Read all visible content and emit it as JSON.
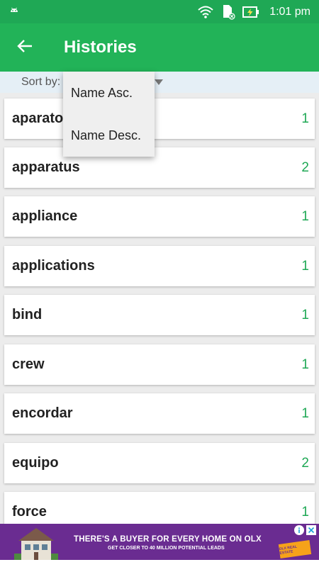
{
  "status_bar": {
    "time": "1:01 pm",
    "icons": [
      "android-icon",
      "wifi-icon",
      "sim-card-icon",
      "battery-charging-icon"
    ]
  },
  "app_bar": {
    "title": "Histories",
    "back_icon": "arrow-left-icon"
  },
  "sort_bar": {
    "label": "Sort by:"
  },
  "sort_dropdown": {
    "options": [
      "Name Asc.",
      "Name Desc."
    ]
  },
  "list": {
    "items": [
      {
        "word": "aparato",
        "count": "1"
      },
      {
        "word": "apparatus",
        "count": "2"
      },
      {
        "word": "appliance",
        "count": "1"
      },
      {
        "word": "applications",
        "count": "1"
      },
      {
        "word": "bind",
        "count": "1"
      },
      {
        "word": "crew",
        "count": "1"
      },
      {
        "word": "encordar",
        "count": "1"
      },
      {
        "word": "equipo",
        "count": "2"
      },
      {
        "word": "force",
        "count": "1"
      }
    ]
  },
  "ad": {
    "headline": "THERE'S A BUYER FOR EVERY HOME ON OLX",
    "subline": "GET CLOSER TO 40 MILLION POTENTIAL LEADS",
    "badge": "OLX REAL ESTATE"
  },
  "colors": {
    "primary": "#22b358",
    "status_bar": "#1fa855",
    "count_text": "#1fa855",
    "sort_bar_bg": "#e5eff6",
    "ad_bg": "#6a2c91"
  }
}
